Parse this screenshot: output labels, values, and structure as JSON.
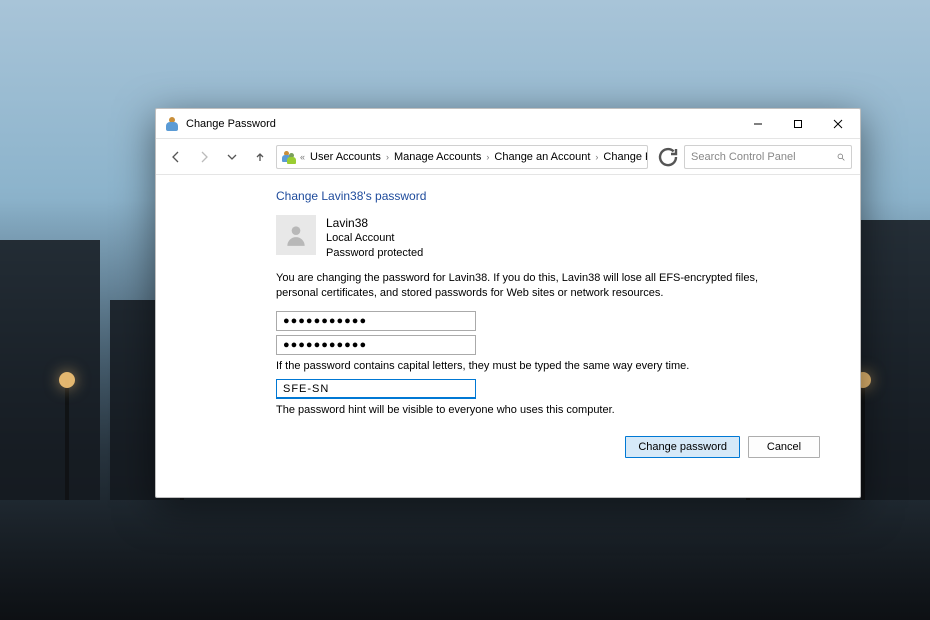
{
  "titlebar": {
    "title": "Change Password"
  },
  "breadcrumb": {
    "prefix": "«",
    "items": [
      "User Accounts",
      "Manage Accounts",
      "Change an Account",
      "Change Password"
    ]
  },
  "search": {
    "placeholder": "Search Control Panel"
  },
  "page": {
    "heading": "Change Lavin38's password",
    "user": {
      "name": "Lavin38",
      "type": "Local Account",
      "status": "Password protected"
    },
    "warning": "You are changing the password for Lavin38.  If you do this, Lavin38 will lose all EFS-encrypted files, personal certificates, and stored passwords for Web sites or network resources.",
    "pw1": "●●●●●●●●●●●",
    "pw2": "●●●●●●●●●●●",
    "caps_note": "If the password contains capital letters, they must be typed the same way every time.",
    "hint": "SFE-SN",
    "hint_note": "The password hint will be visible to everyone who uses this computer."
  },
  "buttons": {
    "primary": "Change password",
    "cancel": "Cancel"
  }
}
